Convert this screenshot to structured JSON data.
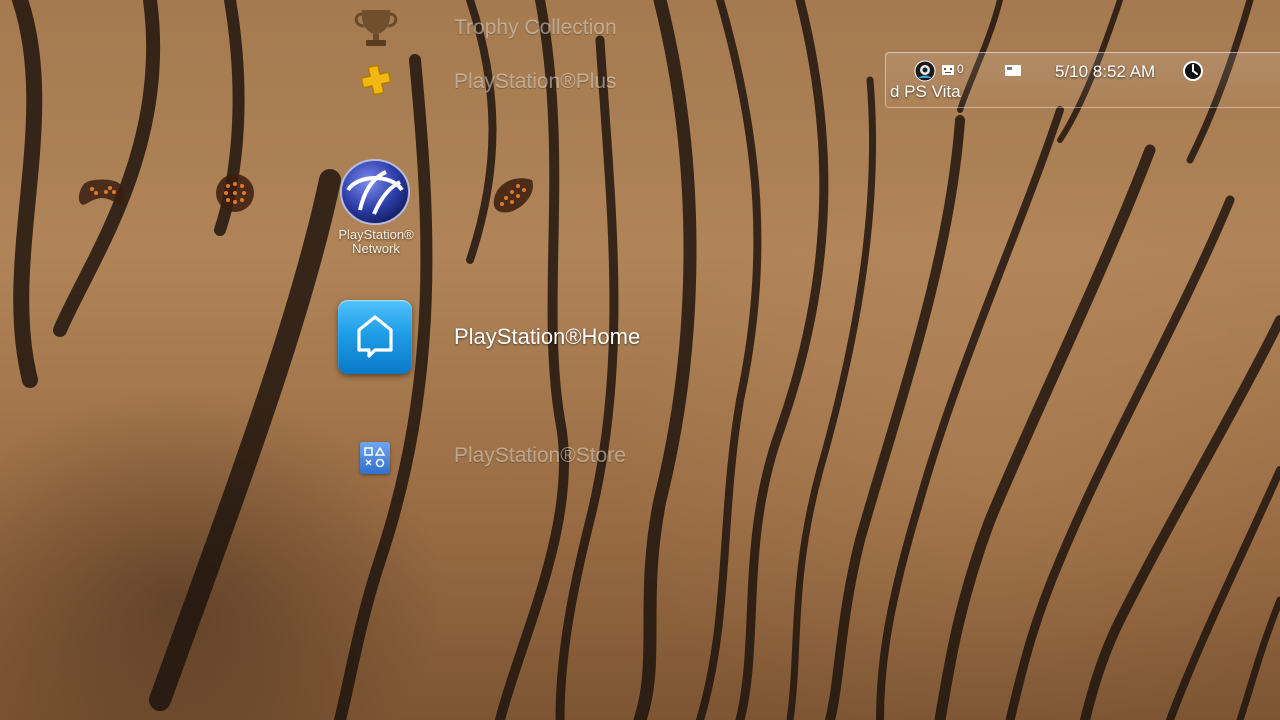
{
  "xmb": {
    "categories": [
      {
        "icon": "gamepad-icon"
      },
      {
        "icon": "tv-icon"
      },
      {
        "icon": "network-icon"
      },
      {
        "icon": "friends-icon"
      }
    ],
    "items": [
      {
        "label": "Trophy Collection",
        "icon": "trophy-icon",
        "selected": false
      },
      {
        "label": "PlayStation®Plus",
        "icon": "playstation-plus-icon",
        "selected": false
      },
      {
        "label": "PlayStation®Home",
        "icon": "playstation-home-icon",
        "selected": true
      },
      {
        "label": "PlayStation®Store",
        "icon": "playstation-store-icon",
        "selected": false
      }
    ],
    "category_label": {
      "line1": "PlayStation®",
      "line2": "Network"
    }
  },
  "status": {
    "messages_count": "0",
    "device_text": "d PS Vita",
    "datetime": "5/10 8:52 AM"
  },
  "colors": {
    "home_icon_bg": "#1e9ee6",
    "psn_icon": "#2c3ea8",
    "plus_icon": "#f0b810"
  }
}
